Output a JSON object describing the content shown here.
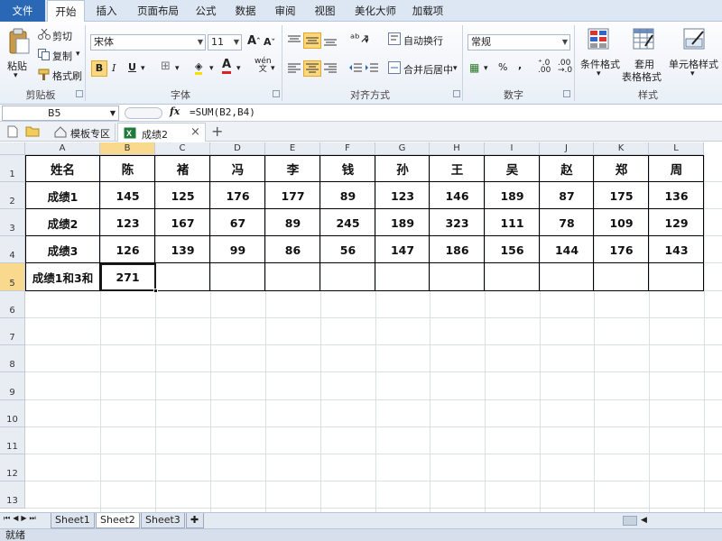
{
  "menu": {
    "file": "文件",
    "tabs": [
      "开始",
      "插入",
      "页面布局",
      "公式",
      "数据",
      "审阅",
      "视图",
      "美化大师",
      "加载项"
    ]
  },
  "ribbon": {
    "clipboard": {
      "paste": "粘贴",
      "cut": "剪切",
      "copy": "复制",
      "format_painter": "格式刷",
      "group": "剪贴板"
    },
    "font": {
      "name": "宋体",
      "size": "11",
      "group": "字体"
    },
    "alignment": {
      "wrap": "自动换行",
      "merge": "合并后居中",
      "group": "对齐方式"
    },
    "number": {
      "format": "常规",
      "group": "数字",
      "percent": "%",
      "comma": ","
    },
    "styles": {
      "conditional": "条件格式",
      "table_format_1": "套用",
      "table_format_2": "表格格式",
      "cell_styles": "单元格样式",
      "group": "样式"
    }
  },
  "formula_bar": {
    "cell_ref": "B5",
    "fx": "fx",
    "formula": "=SUM(B2,B4)"
  },
  "doc_tabs": {
    "template": "模板专区",
    "workbook": "成绩2",
    "add": "+"
  },
  "columns": [
    "A",
    "B",
    "C",
    "D",
    "E",
    "F",
    "G",
    "H",
    "I",
    "J",
    "K",
    "L"
  ],
  "rows": [
    "1",
    "2",
    "3",
    "4",
    "5",
    "6",
    "7",
    "8",
    "9",
    "10",
    "11",
    "12",
    "13"
  ],
  "table": {
    "header": [
      "姓名",
      "陈",
      "褚",
      "冯",
      "李",
      "钱",
      "孙",
      "王",
      "吴",
      "赵",
      "郑",
      "周"
    ],
    "rows": [
      [
        "成绩1",
        "145",
        "125",
        "176",
        "177",
        "89",
        "123",
        "146",
        "189",
        "87",
        "175",
        "136"
      ],
      [
        "成绩2",
        "123",
        "167",
        "67",
        "89",
        "245",
        "189",
        "323",
        "111",
        "78",
        "109",
        "129"
      ],
      [
        "成绩3",
        "126",
        "139",
        "99",
        "86",
        "56",
        "147",
        "186",
        "156",
        "144",
        "176",
        "143"
      ],
      [
        "成绩1和3和",
        "271",
        "",
        "",
        "",
        "",
        "",
        "",
        "",
        "",
        "",
        ""
      ]
    ]
  },
  "sheets": [
    "Sheet1",
    "Sheet2",
    "Sheet3"
  ],
  "active_sheet": "Sheet2",
  "status": "就绪",
  "colors": {
    "file_tab": "#2a68b5",
    "selected_header": "#f9d98e",
    "highlight_button": "#fbd77d"
  }
}
